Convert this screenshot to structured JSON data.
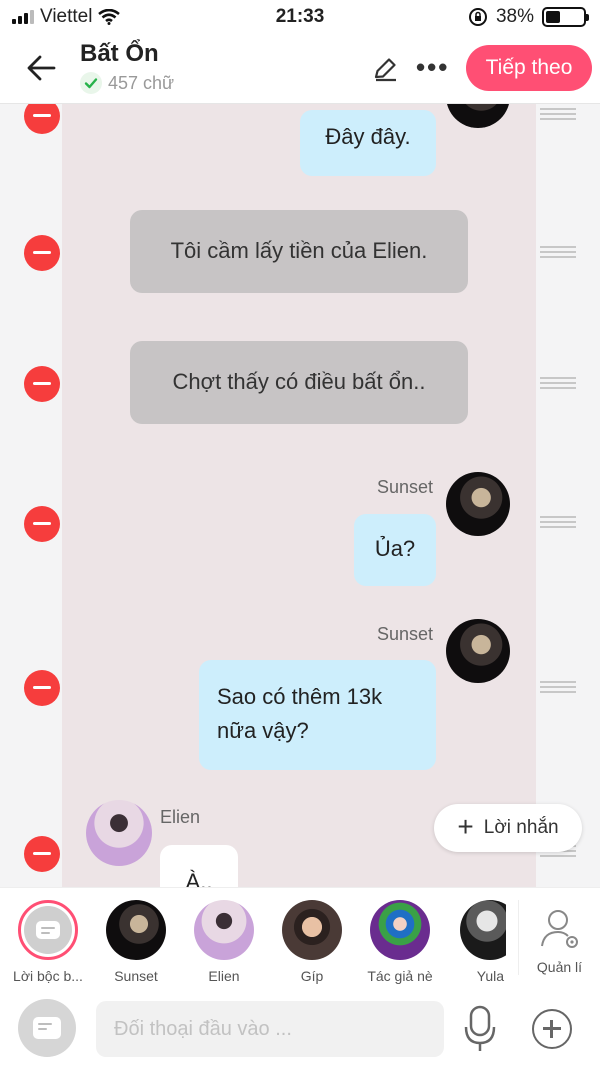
{
  "status": {
    "carrier": "Viettel",
    "time": "21:33",
    "battery": "38%"
  },
  "header": {
    "title": "Bất Ổn",
    "word_count": "457 chữ",
    "next_label": "Tiếp theo",
    "more_label": "•••"
  },
  "messages": [
    {
      "text": "Đây đây.",
      "style": "outgoing"
    },
    {
      "text": "Tôi cầm lấy tiền của Elien.",
      "style": "narration"
    },
    {
      "text": "Chợt thấy có điều bất ổn..",
      "style": "narration"
    },
    {
      "speaker": "Sunset",
      "text": "Ủa?",
      "style": "outgoing"
    },
    {
      "speaker": "Sunset",
      "text": "Sao có thêm 13k nữa vậy?",
      "style": "outgoing"
    },
    {
      "speaker": "Elien",
      "text": "À..",
      "style": "incoming"
    }
  ],
  "add_message_label": "Lời nhắn",
  "characters": [
    {
      "label": "Lời bộc b..."
    },
    {
      "label": "Sunset"
    },
    {
      "label": "Elien"
    },
    {
      "label": "Gíp"
    },
    {
      "label": "Tác giả nè"
    },
    {
      "label": "Yula"
    },
    {
      "label": "Quản lí"
    }
  ],
  "composer": {
    "placeholder": "Đối thoại đầu vào ..."
  },
  "colors": {
    "accent": "#ff4f74",
    "delete": "#f63d3d",
    "outgoing_bubble": "#cdeefc",
    "narration_bubble": "#c7c4c5"
  }
}
